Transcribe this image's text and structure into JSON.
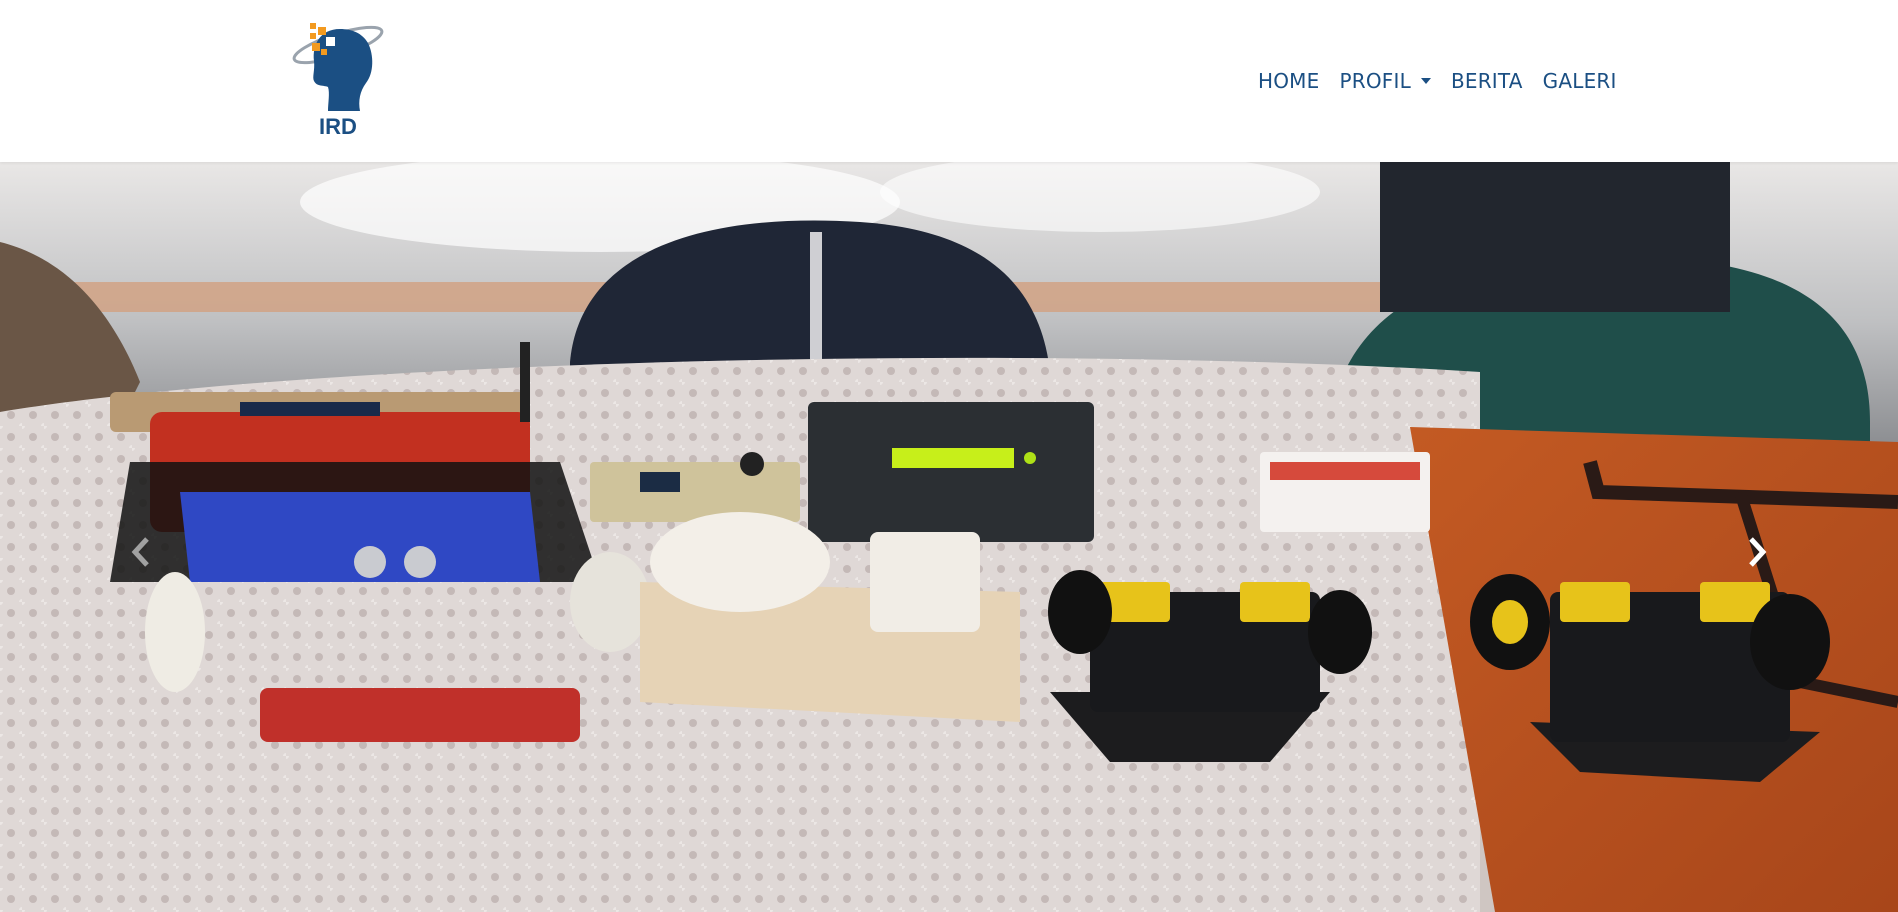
{
  "brand": {
    "logo_text": "IRD",
    "colors": {
      "primary": "#1b4f83",
      "accent": "#f39a1f"
    }
  },
  "nav": {
    "items": [
      {
        "label": "HOME",
        "has_dropdown": false
      },
      {
        "label": "PROFIL",
        "has_dropdown": true
      },
      {
        "label": "BERITA",
        "has_dropdown": false
      },
      {
        "label": "GALERI",
        "has_dropdown": false
      }
    ]
  },
  "carousel": {
    "slide_image": "robot-exhibition-table-photo",
    "prev_icon": "chevron-left-icon",
    "next_icon": "chevron-right-icon"
  }
}
